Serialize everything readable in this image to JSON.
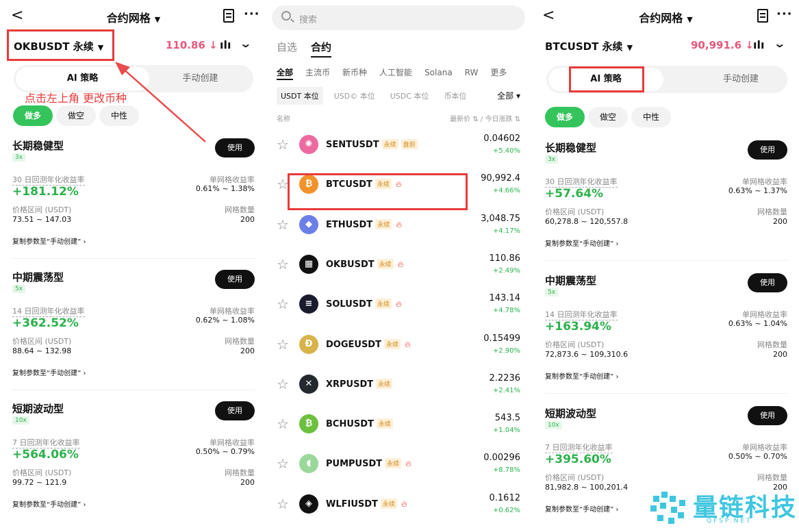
{
  "left": {
    "title": "合约网格",
    "pair": "OKBUSDT 永续",
    "price": "110.86 ↓",
    "seg_on": "AI 策略",
    "seg_off": "手动创建",
    "chips": [
      "做多",
      "做空",
      "中性"
    ],
    "annotation": "点击左上角 更改币种",
    "cards": [
      {
        "name": "长期稳健型",
        "lev": "3x",
        "l1": "30 日回测年化收益率",
        "big": "+181.12%",
        "r1": "单网格收益率",
        "rv": "0.61% ~ 1.38%",
        "l2": "价格区间 (USDT)",
        "lv2": "73.51 ~ 147.03",
        "r2": "网格数量",
        "rv2": "200",
        "copy": "复制参数至“手动创建” ›"
      },
      {
        "name": "中期震荡型",
        "lev": "5x",
        "l1": "14 日回测年化收益率",
        "big": "+362.52%",
        "r1": "单网格收益率",
        "rv": "0.62% ~ 1.08%",
        "l2": "价格区间 (USDT)",
        "lv2": "88.64 ~ 132.98",
        "r2": "网格数量",
        "rv2": "200",
        "copy": "复制参数至“手动创建” ›"
      },
      {
        "name": "短期波动型",
        "lev": "10x",
        "l1": "7 日回测年化收益率",
        "big": "+564.06%",
        "r1": "单网格收益率",
        "rv": "0.50% ~ 0.79%",
        "l2": "价格区间 (USDT)",
        "lv2": "99.72 ~ 121.9",
        "r2": "网格数量",
        "rv2": "200",
        "copy": "复制参数至“手动创建” ›"
      }
    ]
  },
  "mid": {
    "search_placeholder": "搜索",
    "tabs": [
      "自选",
      "合约"
    ],
    "cats": [
      "全部",
      "主流币",
      "新币种",
      "人工智能",
      "Solana",
      "RW",
      "更多"
    ],
    "subs": [
      "USDT 本位",
      "USD© 本位",
      "USDC 本位",
      "币本位"
    ],
    "all": "全部 ▾",
    "hdr_name": "名称",
    "hdr_right": "最新价 ⇅ / 今日涨跌 ⇅",
    "tag_perp": "永续",
    "tag_pre": "盘前",
    "rows": [
      {
        "sym": "SENTUSDT",
        "pr": "0.04602",
        "ch": "+5.40%",
        "pre": true,
        "hot": false,
        "icon": "✺",
        "color": "#ec6aa0"
      },
      {
        "sym": "BTCUSDT",
        "pr": "90,992.4",
        "ch": "+4.66%",
        "pre": false,
        "hot": true,
        "icon": "₿",
        "color": "#f2922b"
      },
      {
        "sym": "ETHUSDT",
        "pr": "3,048.75",
        "ch": "+4.17%",
        "pre": false,
        "hot": true,
        "icon": "◆",
        "color": "#6c7fe8"
      },
      {
        "sym": "OKBUSDT",
        "pr": "110.86",
        "ch": "+2.49%",
        "pre": false,
        "hot": true,
        "icon": "▦",
        "color": "#111111"
      },
      {
        "sym": "SOLUSDT",
        "pr": "143.14",
        "ch": "+4.78%",
        "pre": false,
        "hot": true,
        "icon": "≡",
        "color": "#1b1b2e"
      },
      {
        "sym": "DOGEUSDT",
        "pr": "0.15499",
        "ch": "+2.90%",
        "pre": false,
        "hot": true,
        "icon": "Ð",
        "color": "#d8b34a"
      },
      {
        "sym": "XRPUSDT",
        "pr": "2.2236",
        "ch": "+2.41%",
        "pre": false,
        "hot": false,
        "icon": "✕",
        "color": "#23292f"
      },
      {
        "sym": "BCHUSDT",
        "pr": "543.5",
        "ch": "+1.04%",
        "pre": false,
        "hot": false,
        "icon": "₿",
        "color": "#6cbf3f"
      },
      {
        "sym": "PUMPUSDT",
        "pr": "0.00296",
        "ch": "+8.78%",
        "pre": false,
        "hot": true,
        "icon": "◖",
        "color": "#9ad89a"
      },
      {
        "sym": "WLFIUSDT",
        "pr": "0.1612",
        "ch": "+0.62%",
        "pre": false,
        "hot": true,
        "icon": "◈",
        "color": "#111111"
      }
    ]
  },
  "right": {
    "title": "合约网格",
    "pair": "BTCUSDT 永续",
    "price": "90,991.6 ↓",
    "seg_on": "AI 策略",
    "seg_off": "手动创建",
    "chips": [
      "做多",
      "做空",
      "中性"
    ],
    "cards": [
      {
        "name": "长期稳健型",
        "lev": "3x",
        "l1": "30 日回测年化收益率",
        "big": "+57.64%",
        "r1": "单网格收益率",
        "rv": "0.63% ~ 1.37%",
        "l2": "价格区间 (USDT)",
        "lv2": "60,278.8 ~ 120,557.8",
        "r2": "网格数量",
        "rv2": "200",
        "copy": "复制参数至“手动创建” ›"
      },
      {
        "name": "中期震荡型",
        "lev": "5x",
        "l1": "14 日回测年化收益率",
        "big": "+163.94%",
        "r1": "单网格收益率",
        "rv": "0.63% ~ 1.04%",
        "l2": "价格区间 (USDT)",
        "lv2": "72,873.6 ~ 109,310.6",
        "r2": "网格数量",
        "rv2": "200",
        "copy": "复制参数至“手动创建” ›"
      },
      {
        "name": "短期波动型",
        "lev": "10x",
        "l1": "7 日回测年化收益率",
        "big": "+395.60%",
        "r1": "单网格收益率",
        "rv": "0.50% ~ 0.70%",
        "l2": "价格区间 (USDT)",
        "lv2": "81,982.8 ~ 100,201.4",
        "r2": "网格数量",
        "rv2": "200",
        "copy": "复制参数至“手动创建” ›"
      }
    ]
  },
  "watermark": {
    "text": "量链科技",
    "sub": "QFSP.NET"
  }
}
